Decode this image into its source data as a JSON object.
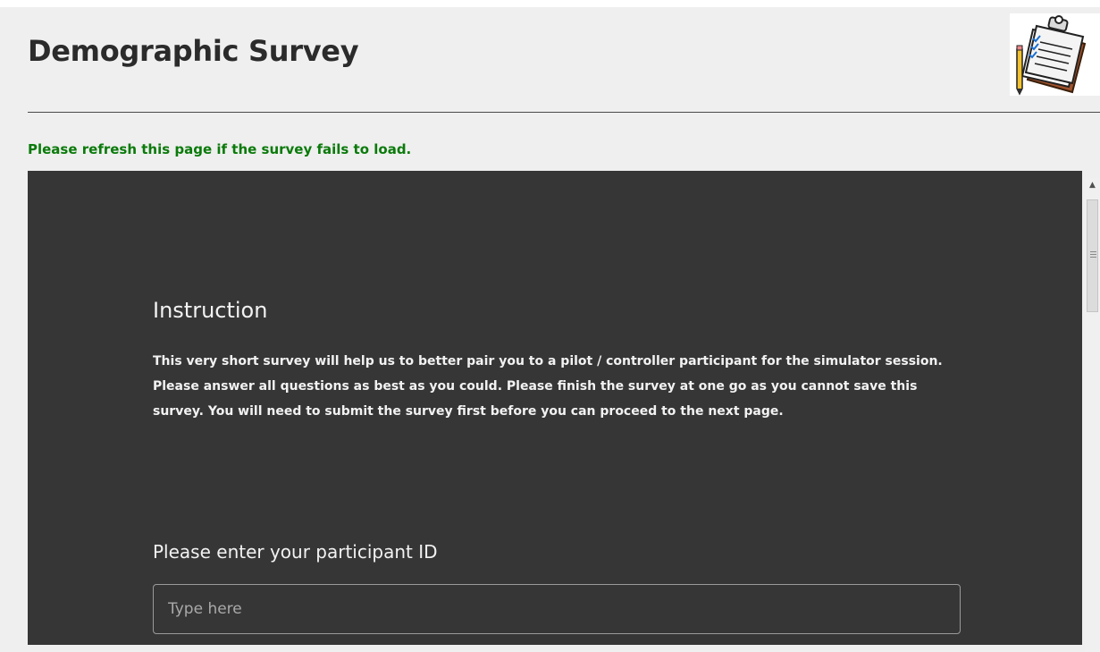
{
  "header": {
    "title": "Demographic Survey",
    "logo_icon": "clipboard-checklist-icon"
  },
  "notice": {
    "text": "Please refresh this page if the survey fails to load.",
    "color": "#0a7a0a"
  },
  "survey": {
    "background_color": "#363636",
    "instruction_heading": "Instruction",
    "instruction_text": "This very short survey will help us to better pair you to a pilot / controller participant for the simulator session. Please answer all questions as best as you could. Please finish the survey at one go as you cannot save this survey. You will need to submit the survey first before you can proceed to the next page.",
    "question_label": "Please enter your participant ID",
    "input": {
      "placeholder": "Type here",
      "value": ""
    }
  },
  "scrollbar": {
    "up_arrow_icon": "scroll-up-arrow-icon"
  }
}
